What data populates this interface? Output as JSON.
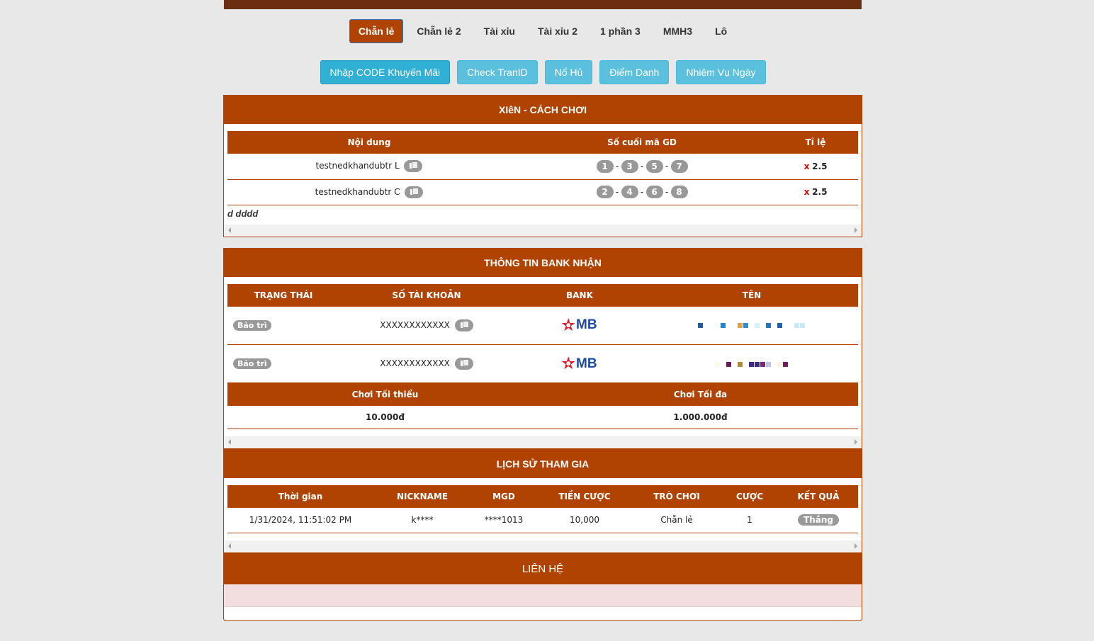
{
  "tabs": [
    {
      "label": "Chẵn lẻ",
      "active": true
    },
    {
      "label": "Chẵn lẻ 2",
      "active": false
    },
    {
      "label": "Tài xỉu",
      "active": false
    },
    {
      "label": "Tài xỉu 2",
      "active": false
    },
    {
      "label": "1 phần 3",
      "active": false
    },
    {
      "label": "MMH3",
      "active": false
    },
    {
      "label": "Lô",
      "active": false
    }
  ],
  "actions": {
    "promo": "Nhập CODE Khuyến Mãi",
    "check": "Check TranID",
    "jackpot": "Nổ Hủ",
    "checkin": "Điểm Danh",
    "daily": "Nhiệm Vụ Ngày"
  },
  "xien": {
    "title": "XIêN - CÁCH CHƠI",
    "headers": {
      "content": "Nội dung",
      "digits": "Số cuối mã GD",
      "rate": "Tỉ lệ"
    },
    "rows": [
      {
        "content": "testnedkhandubtr L",
        "digits": [
          "1",
          "3",
          "5",
          "7"
        ],
        "x": "x",
        "rate": "2.5"
      },
      {
        "content": "testnedkhandubtr C",
        "digits": [
          "2",
          "4",
          "6",
          "8"
        ],
        "x": "x",
        "rate": "2.5"
      }
    ],
    "note": "d dddd"
  },
  "bank": {
    "title": "THÔNG TIN BANK NHẬN",
    "headers": {
      "status": "TRẠNG THÁI",
      "account": "SỐ TÀI KHOẢN",
      "bank": "BANK",
      "name": "TÊN"
    },
    "rows": [
      {
        "status": "Bảo trì",
        "account": "XXXXXXXXXXXX",
        "bank": "MB"
      },
      {
        "status": "Bảo trì",
        "account": "XXXXXXXXXXXX",
        "bank": "MB"
      }
    ],
    "limits_headers": {
      "min": "Chơi Tối thiểu",
      "max": "Chơi Tối đa"
    },
    "limits": {
      "min": "10.000đ",
      "max": "1.000.000đ"
    }
  },
  "history": {
    "title": "LỊCH SỬ THAM GIA",
    "headers": {
      "time": "Thời gian",
      "nick": "NICKNAME",
      "mgd": "MGD",
      "amount": "TIỀN CƯỢC",
      "game": "TRÒ CHƠI",
      "bet": "CƯỢC",
      "result": "KẾT QUẢ"
    },
    "rows": [
      {
        "time": "1/31/2024, 11:51:02 PM",
        "nick": "k****",
        "mgd": "****1013",
        "amount": "10,000",
        "game": "Chẵn lẻ",
        "bet": "1",
        "result": "Thắng"
      }
    ]
  },
  "contact": {
    "title": "LIÊN HỆ"
  },
  "colors": {
    "brand": "#b04302",
    "top_bar": "#6b2e10",
    "button": "#5bc0de",
    "badge": "#999999"
  }
}
